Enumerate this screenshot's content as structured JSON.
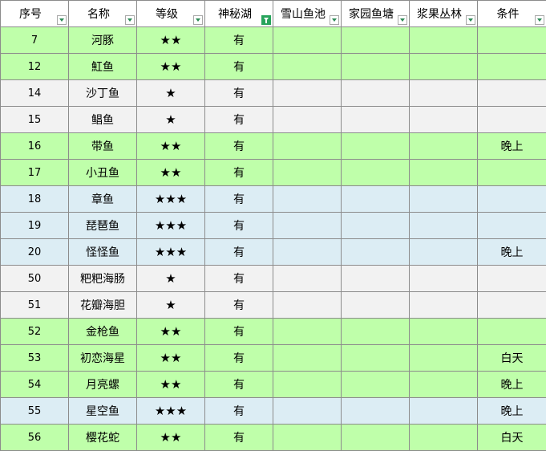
{
  "columns": [
    {
      "label": "序号",
      "filter_active": false
    },
    {
      "label": "名称",
      "filter_active": false
    },
    {
      "label": "等级",
      "filter_active": false
    },
    {
      "label": "神秘湖",
      "filter_active": true
    },
    {
      "label": "雪山鱼池",
      "filter_active": false
    },
    {
      "label": "家园鱼塘",
      "filter_active": false
    },
    {
      "label": "浆果丛林",
      "filter_active": false
    },
    {
      "label": "条件",
      "filter_active": false
    }
  ],
  "rows": [
    {
      "id": "7",
      "name": "河豚",
      "grade": "★★",
      "lake": "有",
      "snow": "",
      "home": "",
      "berry": "",
      "cond": "",
      "color": "green"
    },
    {
      "id": "12",
      "name": "魟鱼",
      "grade": "★★",
      "lake": "有",
      "snow": "",
      "home": "",
      "berry": "",
      "cond": "",
      "color": "green"
    },
    {
      "id": "14",
      "name": "沙丁鱼",
      "grade": "★",
      "lake": "有",
      "snow": "",
      "home": "",
      "berry": "",
      "cond": "",
      "color": "gray"
    },
    {
      "id": "15",
      "name": "鲳鱼",
      "grade": "★",
      "lake": "有",
      "snow": "",
      "home": "",
      "berry": "",
      "cond": "",
      "color": "gray"
    },
    {
      "id": "16",
      "name": "带鱼",
      "grade": "★★",
      "lake": "有",
      "snow": "",
      "home": "",
      "berry": "",
      "cond": "晚上",
      "color": "green"
    },
    {
      "id": "17",
      "name": "小丑鱼",
      "grade": "★★",
      "lake": "有",
      "snow": "",
      "home": "",
      "berry": "",
      "cond": "",
      "color": "green"
    },
    {
      "id": "18",
      "name": "章鱼",
      "grade": "★★★",
      "lake": "有",
      "snow": "",
      "home": "",
      "berry": "",
      "cond": "",
      "color": "blue"
    },
    {
      "id": "19",
      "name": "琵琶鱼",
      "grade": "★★★",
      "lake": "有",
      "snow": "",
      "home": "",
      "berry": "",
      "cond": "",
      "color": "blue"
    },
    {
      "id": "20",
      "name": "怪怪鱼",
      "grade": "★★★",
      "lake": "有",
      "snow": "",
      "home": "",
      "berry": "",
      "cond": "晚上",
      "color": "blue"
    },
    {
      "id": "50",
      "name": "粑粑海肠",
      "grade": "★",
      "lake": "有",
      "snow": "",
      "home": "",
      "berry": "",
      "cond": "",
      "color": "gray"
    },
    {
      "id": "51",
      "name": "花瓣海胆",
      "grade": "★",
      "lake": "有",
      "snow": "",
      "home": "",
      "berry": "",
      "cond": "",
      "color": "gray"
    },
    {
      "id": "52",
      "name": "金枪鱼",
      "grade": "★★",
      "lake": "有",
      "snow": "",
      "home": "",
      "berry": "",
      "cond": "",
      "color": "green"
    },
    {
      "id": "53",
      "name": "初恋海星",
      "grade": "★★",
      "lake": "有",
      "snow": "",
      "home": "",
      "berry": "",
      "cond": "白天",
      "color": "green"
    },
    {
      "id": "54",
      "name": "月亮螺",
      "grade": "★★",
      "lake": "有",
      "snow": "",
      "home": "",
      "berry": "",
      "cond": "晚上",
      "color": "green"
    },
    {
      "id": "55",
      "name": "星空鱼",
      "grade": "★★★",
      "lake": "有",
      "snow": "",
      "home": "",
      "berry": "",
      "cond": "晚上",
      "color": "blue"
    },
    {
      "id": "56",
      "name": "樱花蛇",
      "grade": "★★",
      "lake": "有",
      "snow": "",
      "home": "",
      "berry": "",
      "cond": "白天",
      "color": "green"
    }
  ],
  "colors": {
    "green": "#bfffaa",
    "gray": "#f2f2f2",
    "blue": "#dcedf4",
    "filter_active": "#27a35b"
  }
}
